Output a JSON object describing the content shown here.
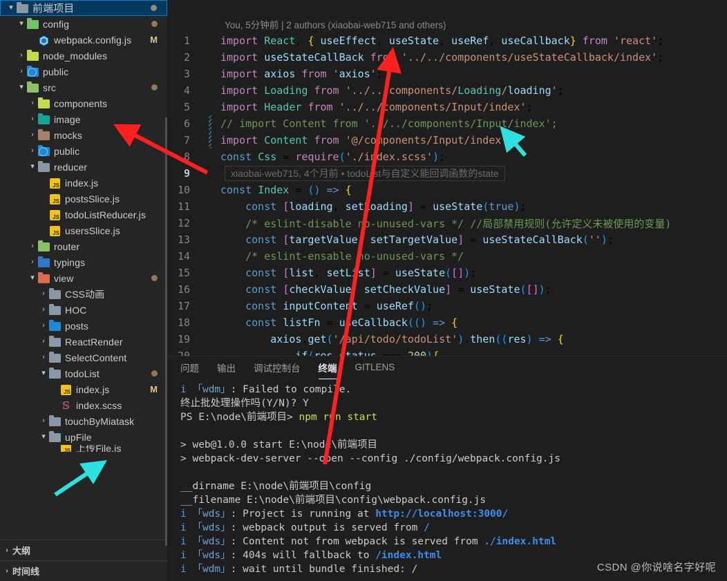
{
  "sidebar": {
    "root": {
      "label": "前端项目",
      "expanded": true,
      "badge": "dot-grey"
    },
    "items": [
      {
        "label": "config",
        "depth": 1,
        "kind": "folder",
        "color": "f-greencfg",
        "twisty": "▾",
        "dot": "tan"
      },
      {
        "label": "webpack.config.js",
        "depth": 2,
        "kind": "webpack",
        "twisty": "",
        "badge": "M"
      },
      {
        "label": "node_modules",
        "depth": 1,
        "kind": "folder",
        "color": "f-lgreen",
        "twisty": "›"
      },
      {
        "label": "public",
        "depth": 1,
        "kind": "folder-globe",
        "color": "f-blue",
        "twisty": "›"
      },
      {
        "label": "src",
        "depth": 1,
        "kind": "folder",
        "color": "f-green",
        "twisty": "▾",
        "dot": "tan"
      },
      {
        "label": "components",
        "depth": 2,
        "kind": "folder",
        "color": "f-lgreen",
        "twisty": "›"
      },
      {
        "label": "image",
        "depth": 2,
        "kind": "folder",
        "color": "f-img",
        "twisty": "›"
      },
      {
        "label": "mocks",
        "depth": 2,
        "kind": "folder",
        "color": "f-brown",
        "twisty": "›"
      },
      {
        "label": "public",
        "depth": 2,
        "kind": "folder-globe",
        "color": "f-blue",
        "twisty": "›"
      },
      {
        "label": "reducer",
        "depth": 2,
        "kind": "folder",
        "color": "f-grey",
        "twisty": "▾"
      },
      {
        "label": "index.js",
        "depth": 3,
        "kind": "js",
        "twisty": ""
      },
      {
        "label": "postsSlice.js",
        "depth": 3,
        "kind": "js",
        "twisty": ""
      },
      {
        "label": "todoListReducer.js",
        "depth": 3,
        "kind": "js",
        "twisty": ""
      },
      {
        "label": "usersSlice.js",
        "depth": 3,
        "kind": "js",
        "twisty": ""
      },
      {
        "label": "router",
        "depth": 2,
        "kind": "folder",
        "color": "f-green",
        "twisty": "›"
      },
      {
        "label": "typings",
        "depth": 2,
        "kind": "folder",
        "color": "f-tsblue",
        "twisty": "›"
      },
      {
        "label": "view",
        "depth": 2,
        "kind": "folder",
        "color": "f-red",
        "twisty": "▾",
        "dot": "tan"
      },
      {
        "label": "CSS动画",
        "depth": 3,
        "kind": "folder",
        "color": "f-grey",
        "twisty": "›"
      },
      {
        "label": "HOC",
        "depth": 3,
        "kind": "folder",
        "color": "f-grey",
        "twisty": "›"
      },
      {
        "label": "posts",
        "depth": 3,
        "kind": "folder",
        "color": "f-blue",
        "twisty": "›"
      },
      {
        "label": "ReactRender",
        "depth": 3,
        "kind": "folder",
        "color": "f-grey",
        "twisty": "›"
      },
      {
        "label": "SelectContent",
        "depth": 3,
        "kind": "folder",
        "color": "f-grey",
        "twisty": "›"
      },
      {
        "label": "todoList",
        "depth": 3,
        "kind": "folder",
        "color": "f-grey",
        "twisty": "▾",
        "dot": "tan"
      },
      {
        "label": "index.js",
        "depth": 4,
        "kind": "js",
        "twisty": "",
        "badge": "M"
      },
      {
        "label": "index.scss",
        "depth": 4,
        "kind": "scss",
        "twisty": ""
      },
      {
        "label": "touchByMiatask",
        "depth": 3,
        "kind": "folder",
        "color": "f-grey",
        "twisty": "›"
      },
      {
        "label": "upFile",
        "depth": 3,
        "kind": "folder",
        "color": "f-grey",
        "twisty": "▾"
      }
    ],
    "bottom_panels": [
      {
        "label": "大纲",
        "twisty": "›"
      },
      {
        "label": "时间线",
        "twisty": "›"
      }
    ]
  },
  "editor": {
    "blame_header": "You, 5分钟前 | 2 authors (xiaobai-web715 and others)",
    "inline_blame": "xiaobai-web715, 4个月前 • todoList与自定义能回调函数的state",
    "lines": [
      {
        "n": "1"
      },
      {
        "n": "2"
      },
      {
        "n": "3"
      },
      {
        "n": "4"
      },
      {
        "n": "5"
      },
      {
        "n": "6"
      },
      {
        "n": "7"
      },
      {
        "n": "8"
      },
      {
        "n": "9"
      },
      {
        "n": "10"
      },
      {
        "n": "11"
      },
      {
        "n": "12"
      },
      {
        "n": "13"
      },
      {
        "n": "14"
      },
      {
        "n": "15"
      },
      {
        "n": "16"
      },
      {
        "n": "17"
      },
      {
        "n": "18"
      },
      {
        "n": "19"
      },
      {
        "n": "20"
      }
    ],
    "code": [
      "import React, { useEffect, useState, useRef, useCallback} from 'react';",
      "import useStateCallBack from '../../components/useStateCallback/index';",
      "import axios from 'axios';",
      "import Loading from '../../components/Loading/loading';",
      "import Header from '../../components/Input/index';",
      "// import Content from '../../components/Input/index';",
      "import Content from '@/components/Input/index';",
      "const Css = require('./index.scss');",
      "",
      "const Index = () => {",
      "    const [loading, setLoading] = useState(true);",
      "    /* eslint-disable no-unused-vars */ //局部禁用规则(允许定义未被使用的变量)",
      "    const [targetValue, setTargetValue] = useStateCallBack('');",
      "    /* eslint-ensable no-unused-vars */",
      "    const [list, setList] = useState([]);",
      "    const [checkValue, setCheckValue] = useState([]);",
      "    const inputContent = useRef();",
      "    const listFn = useCallback(() => {",
      "        axios.get('/api/todo/todoList').then((res) => {",
      "            if(res.status === 200){"
    ]
  },
  "panel": {
    "tabs": [
      {
        "label": "问题",
        "active": false
      },
      {
        "label": "输出",
        "active": false
      },
      {
        "label": "调试控制台",
        "active": false
      },
      {
        "label": "终端",
        "active": true
      },
      {
        "label": "GITLENS",
        "active": false
      }
    ],
    "terminal_lines": [
      "i 「wdm」: Failed to compile.",
      "终止批处理操作吗(Y/N)? Y",
      "PS E:\\node\\前端项目> npm run start",
      "",
      "> web@1.0.0 start E:\\node\\前端项目",
      "> webpack-dev-server --open --config ./config/webpack.config.js",
      "",
      "__dirname E:\\node\\前端项目\\config",
      "__filename E:\\node\\前端项目\\config\\webpack.config.js",
      "i 「wds」: Project is running at http://localhost:3000/",
      "i 「wds」: webpack output is served from /",
      "i 「wds」: Content not from webpack is served from ./index.html",
      "i 「wds」: 404s will fallback to /index.html",
      "i 「wdm」: wait until bundle finished: /"
    ]
  },
  "watermark": "CSDN @你说啥名字好呢",
  "colors": {
    "accent": "#007fd4",
    "selected_bg": "#04395e",
    "modified_badge": "#e2c08d",
    "arrow_red": "#ff2020",
    "arrow_cyan": "#2ee0e0",
    "link": "#3b8eea"
  }
}
